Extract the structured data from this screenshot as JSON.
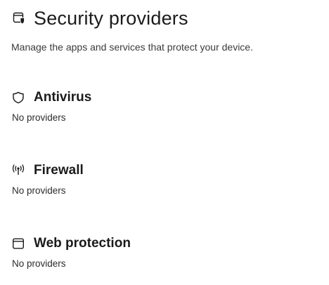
{
  "header": {
    "title": "Security providers",
    "subtitle": "Manage the apps and services that protect your device.",
    "icon": "security-providers-icon"
  },
  "sections": [
    {
      "icon": "shield-icon",
      "title": "Antivirus",
      "status": "No providers"
    },
    {
      "icon": "firewall-antenna-icon",
      "title": "Firewall",
      "status": "No providers"
    },
    {
      "icon": "browser-window-icon",
      "title": "Web protection",
      "status": "No providers"
    }
  ]
}
